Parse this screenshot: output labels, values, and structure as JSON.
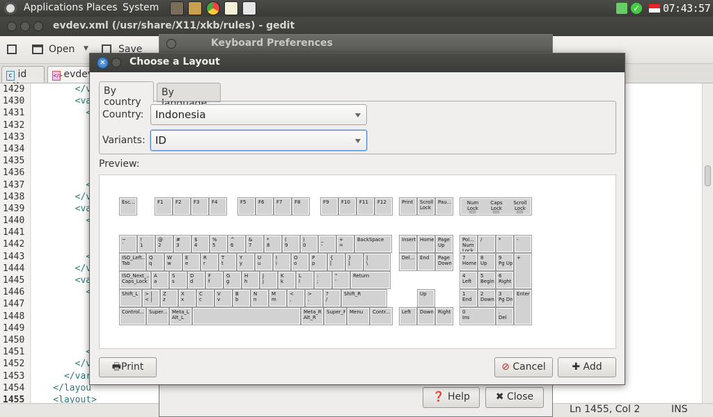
{
  "panel": {
    "menus": [
      "Applications",
      "Places",
      "System"
    ],
    "clock": "07:43:57"
  },
  "gedit": {
    "title": "evdev.xml (/usr/share/X11/xkb/rules) - gedit",
    "toolbar": {
      "open": "Open",
      "save": "Save"
    },
    "tabs": [
      {
        "label": "id"
      },
      {
        "label": "evdev"
      }
    ],
    "line_numbers": [
      "1429",
      "1430",
      "1431",
      "1432",
      "1433",
      "1434",
      "1435",
      "1436",
      "1437",
      "1438",
      "1439",
      "1440",
      "1441",
      "1442",
      "1443",
      "1444",
      "1445",
      "1446",
      "1447",
      "1448",
      "1449",
      "1450",
      "1451",
      "1452",
      "1453",
      "1454",
      "1455"
    ],
    "code_lines": [
      "        </v",
      "        <va",
      "          <",
      "",
      "",
      "",
      "",
      "",
      "          <",
      "        </v",
      "        <va",
      "          <",
      "",
      "",
      "          <",
      "        </v",
      "        <va",
      "          <",
      "",
      "",
      "",
      "",
      "          <",
      "        </v",
      "      </var",
      "    </layou",
      "    <layout>"
    ],
    "status": {
      "position": "Ln 1455, Col 2",
      "mode": "INS"
    }
  },
  "kbprefs": {
    "title": "Keyboard Preferences",
    "help": "Help",
    "close": "Close"
  },
  "dialog": {
    "title": "Choose a Layout",
    "tabs": [
      "By country",
      "By language"
    ],
    "country_label": "Country:",
    "country_value": "Indonesia",
    "variants_label": "Variants:",
    "variants_value": "ID",
    "preview_label": "Preview:",
    "print": "Print",
    "cancel": "Cancel",
    "add": "Add"
  },
  "keyboard": {
    "fkeys": [
      [
        "Esc..."
      ],
      [
        "F1",
        "F2",
        "F3",
        "F4"
      ],
      [
        "F5",
        "F6",
        "F7",
        "F8"
      ],
      [
        "F9",
        "F10",
        "F11",
        "F12"
      ],
      [
        "Print",
        "Scroll\nLock",
        "Pau..."
      ]
    ],
    "indicators": [
      "Num\nLock",
      "Caps\nLock",
      "Scroll\nLock"
    ],
    "row1": [
      "~\n`",
      "!\n1",
      "@\n2",
      "#\n3",
      "$\n4",
      "%\n5",
      "^\n6",
      "&\n7",
      "*\n8",
      "(\n9",
      ")\n0",
      "_\n-",
      "+\n=",
      "BackSpace"
    ],
    "row2": [
      "ISO_Left...\nTab",
      "Q\nq",
      "W\nw",
      "E\ne",
      "R\nr",
      "T\nt",
      "Y\ny",
      "U\nu",
      "I\ni",
      "O\no",
      "P\np",
      "{\n[",
      "}\n]",
      "|\n\\"
    ],
    "row3": [
      "ISO_Next_...\nCaps_Lock",
      "A\na",
      "S\ns",
      "D\nd",
      "F\nf",
      "G\ng",
      "H\nh",
      "J\nj",
      "K\nk",
      "L\nl",
      ":\n;",
      "\"\n'",
      "Return"
    ],
    "row4": [
      "Shift_L",
      "> |\n< |",
      "Z\nz",
      "X\nx",
      "C\nc",
      "V\nv",
      "B\nb",
      "N\nn",
      "M\nm",
      "<\n,",
      ">\n.",
      "?\n/",
      "Shift_R"
    ],
    "row5": [
      "Control...",
      "Super...",
      "Meta_L\nAlt_L",
      "",
      "Meta_R\nAlt_R",
      "Super_R",
      "Menu",
      "Contr..."
    ],
    "nav": [
      "Insert",
      "Home",
      "Page\nUp",
      "Del...",
      "End",
      "Page\nDown",
      "Up",
      "Left",
      "Down",
      "Right"
    ],
    "numpad": [
      "Poi...\nNum\nLock",
      "/",
      "*",
      "-",
      "7\nHome",
      "8\nUp",
      "9\nPg Up",
      "+",
      "4\nLeft",
      "5\nBegin",
      "6\nRight",
      "1\nEnd",
      "2\nDown",
      "3\nPg Dn",
      "Enter",
      "0\nIns",
      ".\nDel"
    ]
  }
}
